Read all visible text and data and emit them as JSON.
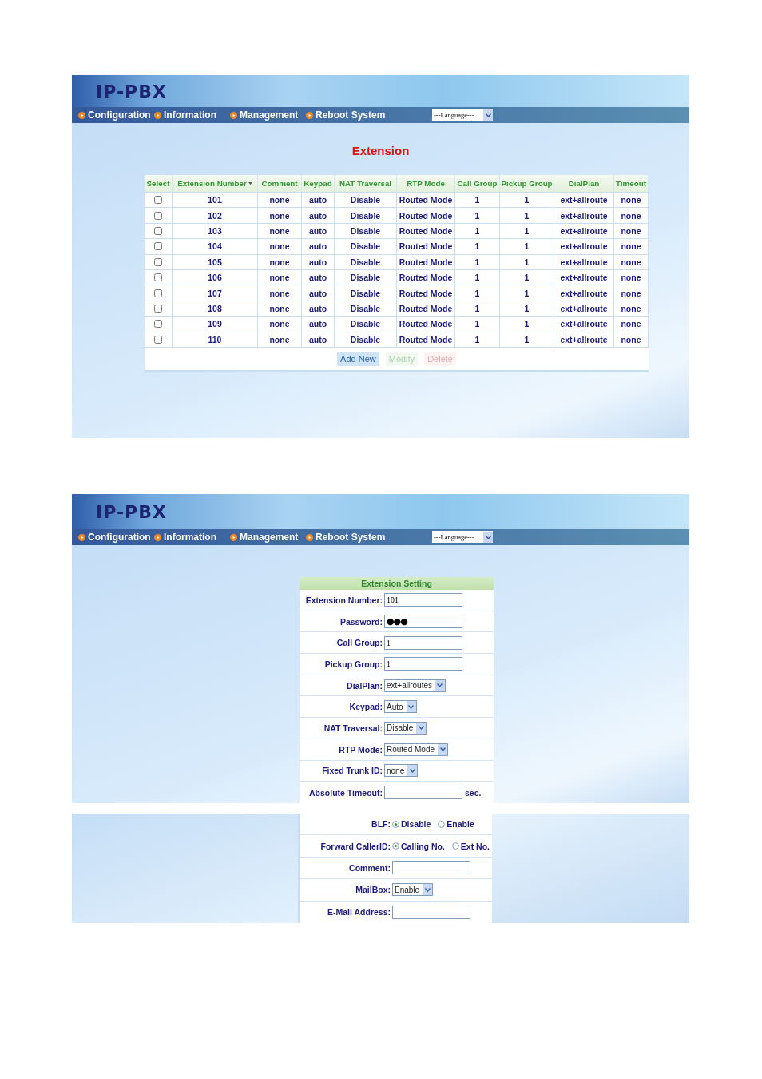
{
  "extension_list": {
    "header": {
      "logo": "IP-PBX",
      "nav": [
        "Configuration",
        "Information",
        "Management",
        "Reboot System"
      ],
      "language": "---Language---"
    },
    "title": "Extension",
    "table": {
      "columns": [
        "Select",
        "Extension Number",
        "Comment",
        "Keypad",
        "NAT Traversal",
        "RTP Mode",
        "Call Group",
        "Pickup Group",
        "DialPlan",
        "Timeout"
      ],
      "rows": [
        {
          "selected": false,
          "cells": [
            "",
            "101",
            "none",
            "auto",
            "Disable",
            "Routed Mode",
            "1",
            "1",
            "ext+allroute",
            "none"
          ]
        },
        {
          "selected": false,
          "cells": [
            "",
            "102",
            "none",
            "auto",
            "Disable",
            "Routed Mode",
            "1",
            "1",
            "ext+allroute",
            "none"
          ]
        },
        {
          "selected": false,
          "cells": [
            "",
            "103",
            "none",
            "auto",
            "Disable",
            "Routed Mode",
            "1",
            "1",
            "ext+allroute",
            "none"
          ]
        },
        {
          "selected": false,
          "cells": [
            "",
            "104",
            "none",
            "auto",
            "Disable",
            "Routed Mode",
            "1",
            "1",
            "ext+allroute",
            "none"
          ]
        },
        {
          "selected": false,
          "cells": [
            "",
            "105",
            "none",
            "auto",
            "Disable",
            "Routed Mode",
            "1",
            "1",
            "ext+allroute",
            "none"
          ]
        },
        {
          "selected": false,
          "cells": [
            "",
            "106",
            "none",
            "auto",
            "Disable",
            "Routed Mode",
            "1",
            "1",
            "ext+allroute",
            "none"
          ]
        },
        {
          "selected": false,
          "cells": [
            "",
            "107",
            "none",
            "auto",
            "Disable",
            "Routed Mode",
            "1",
            "1",
            "ext+allroute",
            "none"
          ]
        },
        {
          "selected": false,
          "cells": [
            "",
            "108",
            "none",
            "auto",
            "Disable",
            "Routed Mode",
            "1",
            "1",
            "ext+allroute",
            "none"
          ]
        },
        {
          "selected": false,
          "cells": [
            "",
            "109",
            "none",
            "auto",
            "Disable",
            "Routed Mode",
            "1",
            "1",
            "ext+allroute",
            "none"
          ]
        },
        {
          "selected": false,
          "cells": [
            "",
            "110",
            "none",
            "auto",
            "Disable",
            "Routed Mode",
            "1",
            "1",
            "ext+allroute",
            "none"
          ]
        }
      ]
    },
    "buttons": [
      {
        "label": "Add New",
        "kind": "add",
        "disabled": false
      },
      {
        "label": "Modify",
        "kind": "modify",
        "disabled": true
      },
      {
        "label": "Delete",
        "kind": "delete",
        "disabled": true
      }
    ]
  },
  "extension_setting": {
    "header": {
      "logo": "IP-PBX",
      "nav": [
        "Configuration",
        "Information",
        "Management",
        "Reboot System"
      ],
      "language": "---Language---"
    },
    "title": "Extension Setting",
    "fields": [
      {
        "label": "Extension Number:",
        "kind": "text",
        "value": "101"
      },
      {
        "label": "Password:",
        "kind": "password",
        "value": "●●●"
      },
      {
        "label": "Call Group:",
        "kind": "text",
        "value": "1"
      },
      {
        "label": "Pickup Group:",
        "kind": "text",
        "value": "1"
      },
      {
        "label": "DialPlan:",
        "kind": "select",
        "value": "ext+allroutes"
      },
      {
        "label": "Keypad:",
        "kind": "select",
        "value": "Auto"
      },
      {
        "label": "NAT Traversal:",
        "kind": "select",
        "value": "Disable"
      },
      {
        "label": "RTP Mode:",
        "kind": "select",
        "value": "Routed Mode"
      },
      {
        "label": "Fixed Trunk ID:",
        "kind": "select",
        "value": "none"
      },
      {
        "label": "Absolute Timeout:",
        "kind": "text",
        "unit": "sec."
      }
    ]
  },
  "extension_setting_continued": {
    "fields": [
      {
        "label": "BLF:",
        "kind": "radio",
        "options": [
          {
            "label": "Disable",
            "selected": true
          },
          {
            "label": "Enable",
            "selected": false
          }
        ]
      },
      {
        "label": "Forward CallerID:",
        "kind": "radio",
        "options": [
          {
            "label": "Calling No.",
            "selected": true
          },
          {
            "label": "Ext No.",
            "selected": false
          }
        ]
      },
      {
        "label": "Comment:",
        "kind": "text"
      },
      {
        "label": "MailBox:",
        "kind": "select",
        "value": "Enable"
      },
      {
        "label": "E-Mail Address:",
        "kind": "text"
      }
    ]
  }
}
